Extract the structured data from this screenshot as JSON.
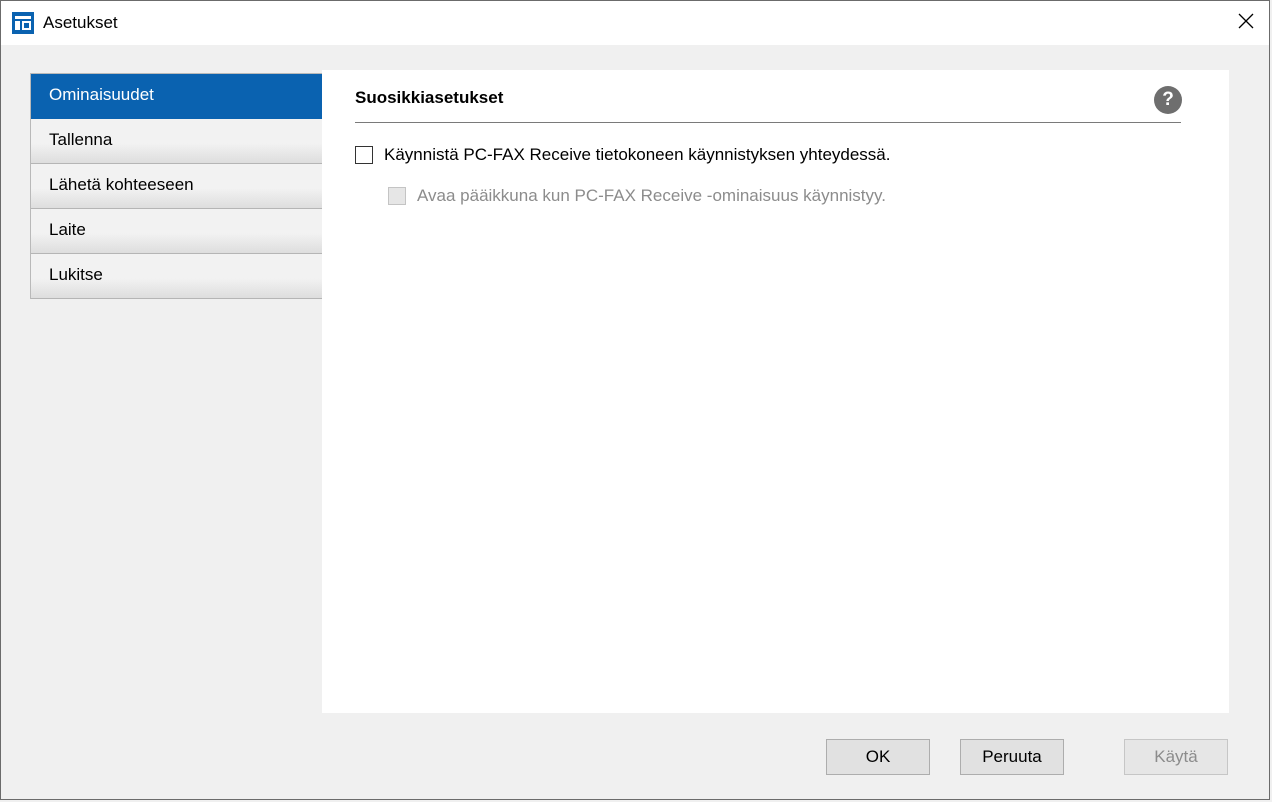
{
  "window": {
    "title": "Asetukset"
  },
  "icons": {
    "app": "settings-window-icon",
    "close": "close-icon",
    "help": "help-icon"
  },
  "colors": {
    "accent": "#0a62b0",
    "help_icon": "#6e6e6e",
    "disabled_text": "#8c8c8c"
  },
  "sidebar": {
    "items": [
      {
        "label": "Ominaisuudet",
        "active": true
      },
      {
        "label": "Tallenna",
        "active": false
      },
      {
        "label": "Lähetä kohteeseen",
        "active": false
      },
      {
        "label": "Laite",
        "active": false
      },
      {
        "label": "Lukitse",
        "active": false
      }
    ]
  },
  "panel": {
    "title": "Suosikkiasetukset",
    "help_glyph": "?",
    "options": [
      {
        "label": "Käynnistä PC-FAX Receive tietokoneen käynnistyksen yhteydessä.",
        "checked": false,
        "enabled": true
      },
      {
        "label": "Avaa pääikkuna kun PC-FAX Receive -ominaisuus käynnistyy.",
        "checked": false,
        "enabled": false
      }
    ]
  },
  "buttons": {
    "ok": "OK",
    "cancel": "Peruuta",
    "apply": "Käytä"
  }
}
